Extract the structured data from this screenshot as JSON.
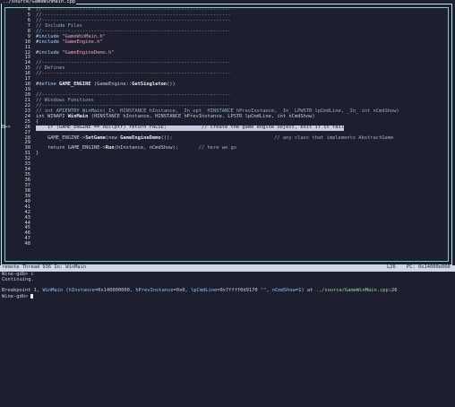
{
  "window": {
    "file_title": "../source/GameWinMain.cpp"
  },
  "source": {
    "current_marker": "B+>",
    "lines": [
      {
        "n": "4",
        "t": "//-----------------------------------------------------------------",
        "k": "comment"
      },
      {
        "n": "5",
        "t": "//-----------------------------------------------------------------",
        "k": "comment"
      },
      {
        "n": "6",
        "t": "//-----------------------------------------------------------------",
        "k": "comment"
      },
      {
        "n": "7",
        "t": "// Include Files",
        "k": "comment"
      },
      {
        "n": "8",
        "t": "//-----------------------------------------------------------------",
        "k": "comment"
      },
      {
        "n": "9",
        "t": "#include \"GameWinMain.h\"",
        "k": "include"
      },
      {
        "n": "10",
        "t": "#include \"GameEngine.h\"",
        "k": "include"
      },
      {
        "n": "11",
        "t": "",
        "k": "plain"
      },
      {
        "n": "12",
        "t": "#include \"GameEngineDemo.h\"",
        "k": "include"
      },
      {
        "n": "13",
        "t": "",
        "k": "plain"
      },
      {
        "n": "14",
        "t": "//-----------------------------------------------------------------",
        "k": "comment"
      },
      {
        "n": "15",
        "t": "// Defines",
        "k": "comment"
      },
      {
        "n": "16",
        "t": "//-----------------------------------------------------------------",
        "k": "comment"
      },
      {
        "n": "17",
        "t": "",
        "k": "plain"
      },
      {
        "n": "18",
        "t": "#define GAME_ENGINE (GameEngine::GetSingleton())",
        "k": "define"
      },
      {
        "n": "19",
        "t": "",
        "k": "plain"
      },
      {
        "n": "20",
        "t": "//-----------------------------------------------------------------",
        "k": "comment"
      },
      {
        "n": "21",
        "t": "// Windows Functions",
        "k": "comment"
      },
      {
        "n": "22",
        "t": "//-----------------------------------------------------------------",
        "k": "comment"
      },
      {
        "n": "23",
        "t": "// int APIENTRY WinMain(_In_ HINSTANCE hInstance, _In_opt_ HINSTANCE hPrevInstance, _In_ LPWSTR lpCmdLine, _In_ int nCmdShow)",
        "k": "comment"
      },
      {
        "n": "24",
        "t": "int WINAPI WinMain (HINSTANCE hInstance, HINSTANCE hPrevInstance, LPSTR lpCmdLine, int nCmdShow)",
        "k": "decl"
      },
      {
        "n": "25",
        "t": "{",
        "k": "plain"
      },
      {
        "n": "26",
        "t": "    if (GAME_ENGINE == nullptr) return FALSE;            // create the game engine object, exit if it fails",
        "k": "current"
      },
      {
        "n": "27",
        "t": "",
        "k": "plain"
      },
      {
        "n": "28",
        "t": "    GAME_ENGINE->SetGame(new GameEngineDemo());                                   // any class that implements AbstractGame",
        "k": "setgame"
      },
      {
        "n": "29",
        "t": "",
        "k": "plain"
      },
      {
        "n": "30",
        "t": "    return GAME_ENGINE->Run(hInstance, nCmdShow);       // here we go",
        "k": "ret"
      },
      {
        "n": "31",
        "t": "}",
        "k": "plain"
      },
      {
        "n": "32",
        "t": "",
        "k": "plain"
      },
      {
        "n": "33",
        "t": "",
        "k": "plain"
      },
      {
        "n": "34",
        "t": "",
        "k": "plain"
      },
      {
        "n": "35",
        "t": "",
        "k": "plain"
      },
      {
        "n": "36",
        "t": "",
        "k": "plain"
      },
      {
        "n": "37",
        "t": "",
        "k": "plain"
      },
      {
        "n": "38",
        "t": "",
        "k": "plain"
      },
      {
        "n": "39",
        "t": "",
        "k": "plain"
      },
      {
        "n": "40",
        "t": "",
        "k": "plain"
      },
      {
        "n": "41",
        "t": "",
        "k": "plain"
      },
      {
        "n": "42",
        "t": "",
        "k": "plain"
      },
      {
        "n": "43",
        "t": "",
        "k": "plain"
      },
      {
        "n": "44",
        "t": "",
        "k": "plain"
      },
      {
        "n": "45",
        "t": "",
        "k": "plain"
      },
      {
        "n": "46",
        "t": "",
        "k": "plain"
      },
      {
        "n": "47",
        "t": "",
        "k": "plain"
      },
      {
        "n": "48",
        "t": "",
        "k": "plain"
      }
    ]
  },
  "status": {
    "thread": "remote Thread 936 In: WinMain",
    "line": "L26",
    "pc": "PC: 0x14000e060"
  },
  "console": {
    "l1": "Wine-gdb> c",
    "l2": "Continuing.",
    "bp_prefix": "Breakpoint 1, ",
    "bp_fn": "WinMain",
    "bp_args_open": " (",
    "bp_a1n": "hInstance",
    "bp_a1v": "=0x140000000, ",
    "bp_a2n": "hPrevInstance",
    "bp_a2v": "=0x0, ",
    "bp_a3n": "lpCmdLine",
    "bp_a3v": "=0x7ffff0d9170 ",
    "bp_a3s": "\"\"",
    "bp_a4sep": ", ",
    "bp_a4n": "nCmdShow",
    "bp_a4v": "=1) at ",
    "bp_file": "../source/GameWinMain.cpp",
    "bp_line": ":26",
    "prompt": "Wine-gdb> "
  },
  "colors": {
    "background": "#1e1f2e",
    "frame": "#b9e8e2",
    "status_bar": "#cfd6e4"
  }
}
